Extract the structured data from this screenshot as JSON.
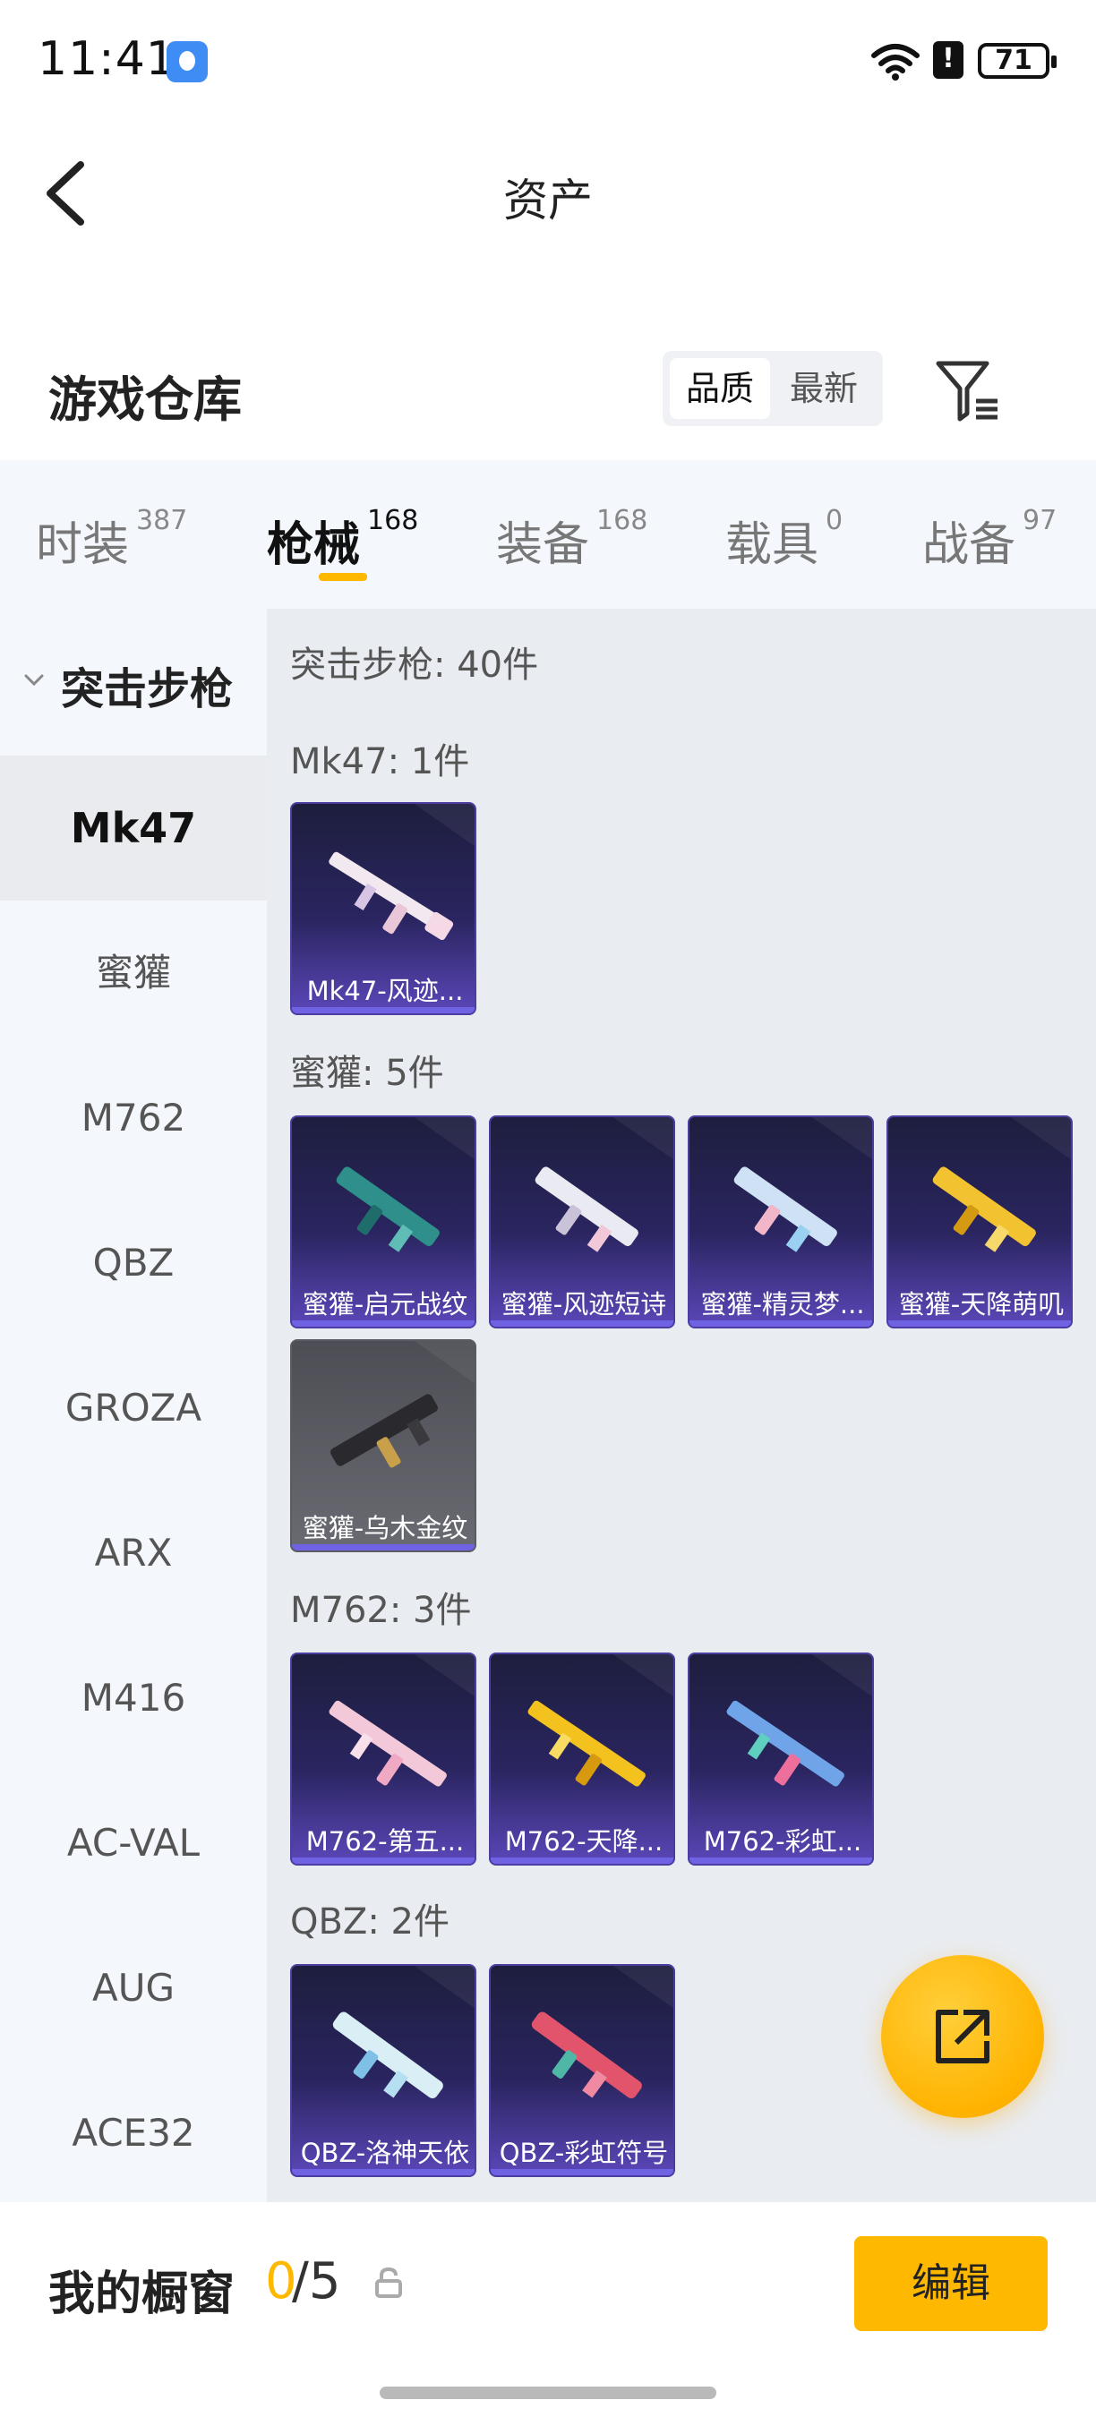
{
  "status_bar": {
    "time": "11:41",
    "battery": "71"
  },
  "header": {
    "title": "资产"
  },
  "warehouse": {
    "title": "游戏仓库",
    "sort_options": [
      "品质",
      "最新"
    ]
  },
  "tabs": [
    {
      "label": "时装",
      "count": "387"
    },
    {
      "label": "枪械",
      "count": "168"
    },
    {
      "label": "装备",
      "count": "168"
    },
    {
      "label": "载具",
      "count": "0"
    },
    {
      "label": "战备",
      "count": "97"
    }
  ],
  "sidebar": {
    "group_label": "突击步枪",
    "items": [
      "Mk47",
      "蜜獾",
      "M762",
      "QBZ",
      "GROZA",
      "ARX",
      "M416",
      "AC-VAL",
      "AUG",
      "ACE32"
    ]
  },
  "main": {
    "header": "突击步枪: 40件",
    "sections": [
      {
        "title": "Mk47: 1件",
        "items": [
          "Mk47-风迹..."
        ]
      },
      {
        "title": "蜜獾: 5件",
        "items": [
          "蜜獾-启元战纹",
          "蜜獾-风迹短诗",
          "蜜獾-精灵梦...",
          "蜜獾-天降萌叽",
          "蜜獾-乌木金纹"
        ]
      },
      {
        "title": "M762: 3件",
        "items": [
          "M762-第五...",
          "M762-天降...",
          "M762-彩虹..."
        ]
      },
      {
        "title": "QBZ: 2件",
        "items": [
          "QBZ-洛神天依",
          "QBZ-彩虹符号"
        ]
      }
    ]
  },
  "bottom_bar": {
    "showcase_label": "我的橱窗",
    "showcase_current": "0",
    "showcase_total": "/5",
    "edit_label": "编辑"
  }
}
